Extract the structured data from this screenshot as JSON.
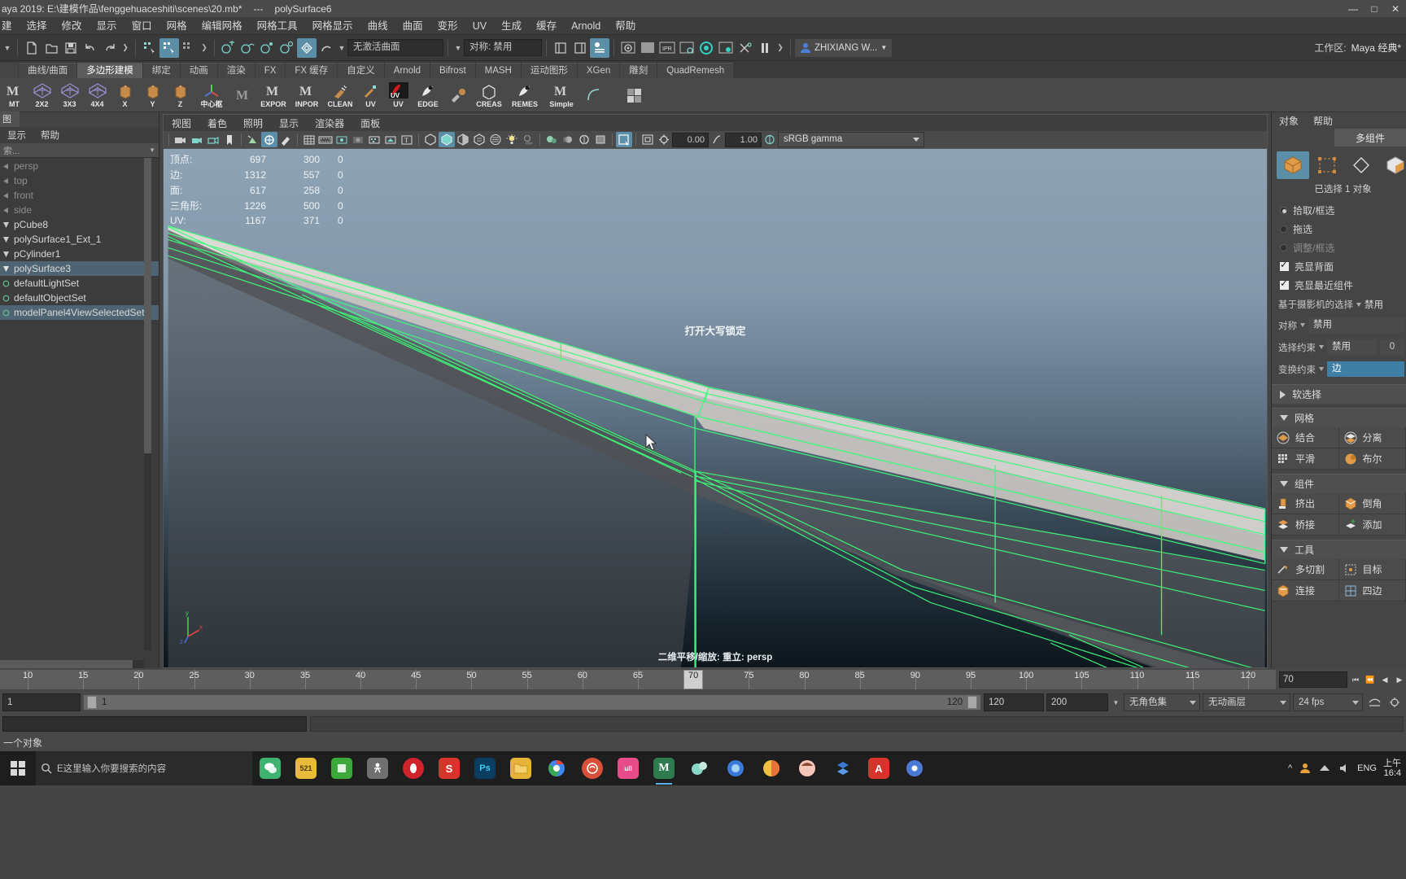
{
  "titlebar": {
    "app_path": "aya 2019: E:\\建模作品\\fenggehuaceshiti\\scenes\\20.mb*",
    "separator": "---",
    "object": "polySurface6",
    "minimize": "—",
    "maximize": "□",
    "close": "✕"
  },
  "menubar": {
    "items": [
      {
        "label": "建"
      },
      {
        "label": "选择"
      },
      {
        "label": "修改"
      },
      {
        "label": "显示"
      },
      {
        "label": "窗口"
      },
      {
        "label": "网格"
      },
      {
        "label": "编辑网格"
      },
      {
        "label": "网格工具"
      },
      {
        "label": "网格显示"
      },
      {
        "label": "曲线"
      },
      {
        "label": "曲面"
      },
      {
        "label": "变形"
      },
      {
        "label": "UV"
      },
      {
        "label": "生成"
      },
      {
        "label": "缓存"
      },
      {
        "label": "Arnold"
      },
      {
        "label": "帮助"
      }
    ]
  },
  "statusline": {
    "surface_field": "无激活曲面",
    "symmetry_field": "对称: 禁用",
    "user": "ZHIXIANG W...",
    "workspace_label": "工作区:",
    "workspace_value": "Maya 经典*"
  },
  "shelf": {
    "tabs": [
      {
        "label": "曲线/曲面",
        "active": false
      },
      {
        "label": "多边形建模",
        "active": true
      },
      {
        "label": "绑定",
        "active": false
      },
      {
        "label": "动画",
        "active": false
      },
      {
        "label": "渲染",
        "active": false
      },
      {
        "label": "FX",
        "active": false
      },
      {
        "label": "FX 缓存",
        "active": false
      },
      {
        "label": "自定义",
        "active": false
      },
      {
        "label": "Arnold",
        "active": false
      },
      {
        "label": "Bifrost",
        "active": false
      },
      {
        "label": "MASH",
        "active": false
      },
      {
        "label": "运动图形",
        "active": false
      },
      {
        "label": "XGen",
        "active": false
      },
      {
        "label": "雕刻",
        "active": false
      },
      {
        "label": "QuadRemesh",
        "active": false
      }
    ],
    "buttons": [
      {
        "label": "MT",
        "icon": "m-icon"
      },
      {
        "label": "2X2",
        "icon": "grid-cube-icon"
      },
      {
        "label": "3X3",
        "icon": "grid-cube-icon"
      },
      {
        "label": "4X4",
        "icon": "grid-cube-icon"
      },
      {
        "label": "X",
        "icon": "axis-box-icon"
      },
      {
        "label": "Y",
        "icon": "axis-box-icon"
      },
      {
        "label": "Z",
        "icon": "axis-box-icon"
      },
      {
        "label": "中心枢",
        "icon": "pivot-icon"
      },
      {
        "label": "",
        "icon": "m-icon"
      },
      {
        "label": "EXPOR",
        "icon": "m-icon"
      },
      {
        "label": "INPOR",
        "icon": "m-icon"
      },
      {
        "label": "CLEAN",
        "icon": "broom-icon"
      },
      {
        "label": "UV",
        "icon": "uv-tool-icon"
      },
      {
        "label": "UV",
        "icon": "uv-red-icon"
      },
      {
        "label": "EDGE",
        "icon": "edge-icon"
      },
      {
        "label": "",
        "icon": "brush-icon"
      },
      {
        "label": "CREAS",
        "icon": "crease-icon"
      },
      {
        "label": "REMES",
        "icon": "remesh-icon"
      },
      {
        "label": "Simple",
        "icon": "m-icon"
      },
      {
        "label": "",
        "icon": "curve-icon"
      },
      {
        "label": "",
        "icon": "cube-grid-icon"
      }
    ]
  },
  "outliner": {
    "tab_label": "图",
    "menu": [
      {
        "label": "显示"
      },
      {
        "label": "帮助"
      }
    ],
    "search_placeholder": "索...",
    "items": [
      {
        "label": "persp",
        "icon": "camera-icon",
        "dim": true,
        "selected": false
      },
      {
        "label": "top",
        "icon": "camera-icon",
        "dim": true,
        "selected": false
      },
      {
        "label": "front",
        "icon": "camera-icon",
        "dim": true,
        "selected": false
      },
      {
        "label": "side",
        "icon": "camera-icon",
        "dim": true,
        "selected": false
      },
      {
        "label": "pCube8",
        "icon": "transform-icon",
        "dim": false,
        "selected": false
      },
      {
        "label": "polySurface1_Ext_1",
        "icon": "transform-icon",
        "dim": false,
        "selected": false
      },
      {
        "label": "pCylinder1",
        "icon": "transform-icon",
        "dim": false,
        "selected": false
      },
      {
        "label": "polySurface3",
        "icon": "transform-icon",
        "dim": false,
        "selected": true
      },
      {
        "label": "defaultLightSet",
        "icon": "set-icon",
        "dim": false,
        "selected": false
      },
      {
        "label": "defaultObjectSet",
        "icon": "set-icon",
        "dim": false,
        "selected": false
      },
      {
        "label": "modelPanel4ViewSelectedSet",
        "icon": "set-icon",
        "dim": false,
        "selected": true
      }
    ]
  },
  "viewport": {
    "menu": [
      {
        "label": "视图"
      },
      {
        "label": "着色"
      },
      {
        "label": "照明"
      },
      {
        "label": "显示"
      },
      {
        "label": "渲染器"
      },
      {
        "label": "面板"
      }
    ],
    "exposure": "0.00",
    "gamma": "1.00",
    "colorspace": "sRGB gamma",
    "capslock_message": "打开大写锁定",
    "bottom_text": "二维平移/缩放: 重立: persp",
    "hud": {
      "headers": [
        "",
        "",
        "",
        ""
      ],
      "rows": [
        {
          "label": "顶点:",
          "total": "697",
          "selected": "300",
          "other": "0"
        },
        {
          "label": "边:",
          "total": "1312",
          "selected": "557",
          "other": "0"
        },
        {
          "label": "面:",
          "total": "617",
          "selected": "258",
          "other": "0"
        },
        {
          "label": "三角形:",
          "total": "1226",
          "selected": "500",
          "other": "0"
        },
        {
          "label": "UV:",
          "total": "1167",
          "selected": "371",
          "other": "0"
        }
      ]
    },
    "axis": {
      "x": "x",
      "y": "y",
      "z": "z"
    }
  },
  "rightpanel": {
    "menu": [
      {
        "label": "对象"
      },
      {
        "label": "帮助"
      }
    ],
    "tab_label": "多组件",
    "mode_icons": [
      {
        "name": "object-mode-icon",
        "active": true
      },
      {
        "name": "vertex-mode-icon",
        "active": false
      },
      {
        "name": "edge-mode-icon",
        "active": false
      },
      {
        "name": "face-mode-icon",
        "active": false
      }
    ],
    "selection_count": "已选择 1 对象",
    "radios": [
      {
        "label": "拾取/框选",
        "checked": true,
        "disabled": false
      },
      {
        "label": "拖选",
        "checked": false,
        "disabled": false
      },
      {
        "label": "调整/框选",
        "checked": false,
        "disabled": true
      }
    ],
    "checks": [
      {
        "label": "亮显背面",
        "checked": true
      },
      {
        "label": "亮显最近组件",
        "checked": true
      }
    ],
    "dropdowns": [
      {
        "label": "基于摄影机的选择",
        "value": "禁用",
        "num": null,
        "highlight": false
      },
      {
        "label": "对称",
        "value": "禁用",
        "num": null,
        "highlight": false
      },
      {
        "label": "选择约束",
        "value": "禁用",
        "num": "0",
        "highlight": false
      },
      {
        "label": "变换约束",
        "value": "边",
        "num": null,
        "highlight": true
      }
    ],
    "soft_selection": "软选择",
    "sections": [
      {
        "title": "网格",
        "expanded": true,
        "cells": [
          {
            "label": "结合",
            "icon": "combine-icon"
          },
          {
            "label": "分离",
            "icon": "separate-icon"
          },
          {
            "label": "平滑",
            "icon": "smooth-icon"
          },
          {
            "label": "布尔",
            "icon": "boolean-icon"
          }
        ]
      },
      {
        "title": "组件",
        "expanded": true,
        "cells": [
          {
            "label": "挤出",
            "icon": "extrude-icon"
          },
          {
            "label": "倒角",
            "icon": "bevel-icon"
          },
          {
            "label": "桥接",
            "icon": "bridge-icon"
          },
          {
            "label": "添加",
            "icon": "add-divisions-icon"
          }
        ]
      },
      {
        "title": "工具",
        "expanded": true,
        "cells": [
          {
            "label": "多切割",
            "icon": "multicut-icon"
          },
          {
            "label": "目标",
            "icon": "target-weld-icon"
          },
          {
            "label": "连接",
            "icon": "connect-icon"
          },
          {
            "label": "四边",
            "icon": "quad-draw-icon"
          }
        ]
      }
    ]
  },
  "timeslider": {
    "ticks": [
      "10",
      "15",
      "20",
      "25",
      "30",
      "35",
      "40",
      "45",
      "50",
      "55",
      "60",
      "65",
      "70",
      "75",
      "80",
      "85",
      "90",
      "95",
      "100",
      "105",
      "110",
      "115",
      "120"
    ],
    "current_frame": "70",
    "current_field": "70",
    "buttons": [
      "⏮",
      "⏪",
      "◀",
      "▶",
      "⏩",
      "⏭"
    ]
  },
  "rangeslider": {
    "start": "1",
    "range_start": "1",
    "range_end": "120",
    "anim_end": "120",
    "playback_end": "200",
    "character_set": "无角色集",
    "anim_layer": "无动画层",
    "fps": "24 fps"
  },
  "statusbar": {
    "message": "一个对象"
  },
  "taskbar": {
    "search_placeholder": "E这里输入你要搜索的内容",
    "apps": [
      {
        "name": "wechat-icon",
        "glyph": "",
        "color": "#3eb370",
        "active": false
      },
      {
        "name": "notes-icon",
        "glyph": "521",
        "color": "#e8bb3a",
        "active": false
      },
      {
        "name": "green-app-icon",
        "glyph": "",
        "color": "#3aa93a",
        "active": false
      },
      {
        "name": "runner-icon",
        "glyph": "人",
        "color": "#6f6f6f",
        "active": false
      },
      {
        "name": "opera-icon",
        "glyph": "O",
        "color": "#d0232b",
        "active": false
      },
      {
        "name": "s-app-icon",
        "glyph": "S",
        "color": "#d6332a",
        "active": false
      },
      {
        "name": "photoshop-icon",
        "glyph": "Ps",
        "color": "#0a3d62",
        "active": false
      },
      {
        "name": "folder-icon",
        "glyph": "",
        "color": "#e8b33a",
        "active": false
      },
      {
        "name": "chrome-icon",
        "glyph": "",
        "color": "#e84b3a",
        "active": false
      },
      {
        "name": "ubisoft-icon",
        "glyph": "U",
        "color": "#d84f3a",
        "active": false
      },
      {
        "name": "lolita-icon",
        "glyph": "ull",
        "color": "#e84b8a",
        "active": false
      },
      {
        "name": "maya-icon",
        "glyph": "M",
        "color": "#2f7a4e",
        "active": true
      },
      {
        "name": "bubble-icon",
        "glyph": "",
        "color": "#8ad6c8",
        "active": false
      },
      {
        "name": "blue-app-icon",
        "glyph": "",
        "color": "#3a7ad6",
        "active": false
      },
      {
        "name": "color-app-icon",
        "glyph": "",
        "color": "#e8a23a",
        "active": false
      },
      {
        "name": "anime-app-icon",
        "glyph": "",
        "color": "#e8736a",
        "active": false
      },
      {
        "name": "dropbox-icon",
        "glyph": "",
        "color": "#3a7ad6",
        "active": false
      },
      {
        "name": "red-a-icon",
        "glyph": "A",
        "color": "#d6332a",
        "active": false
      },
      {
        "name": "media-icon",
        "glyph": "",
        "color": "#4a7ad6",
        "active": false
      }
    ],
    "tray": {
      "chevron": "^",
      "lang": "ENG",
      "time": "上午",
      "date": "16:4"
    }
  }
}
